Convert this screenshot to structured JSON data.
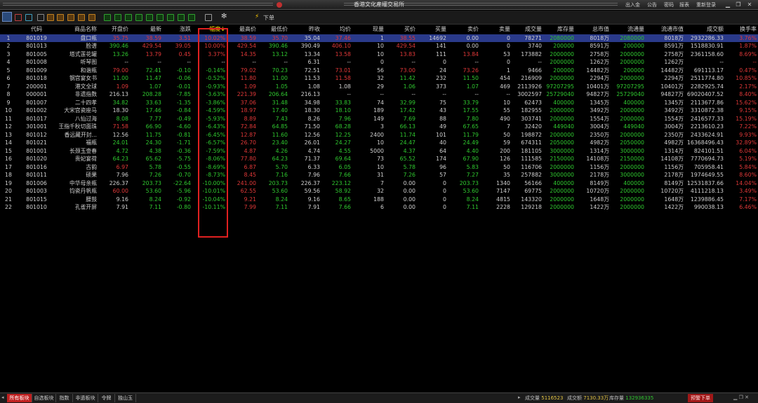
{
  "app_title": "香港文化產權交易所",
  "title_links": [
    "出入金",
    "公告",
    "密码",
    "报表",
    "重新登录"
  ],
  "window_buttons": [
    "▁",
    "❐",
    "✕"
  ],
  "toolbar": {
    "order_label": "下单"
  },
  "columns": [
    "",
    "代码",
    "商品名称",
    "开盘价",
    "最新",
    "涨跌",
    "幅度↓",
    "最高价",
    "最低价",
    "昨收",
    "均价",
    "现量",
    "买价",
    "买量",
    "卖价",
    "卖量",
    "成交量",
    "库存量",
    "总市值",
    "流通量",
    "流通市值",
    "成交额",
    "换手率"
  ],
  "rows": [
    [
      "1",
      "801019",
      "盘口瓶",
      "35.75",
      "38.59",
      "3.51",
      "10.02%",
      "38.59",
      "35.70",
      "35.04",
      "37.46",
      "1",
      "38.55",
      "14692",
      "0.00",
      "0",
      "78271",
      "2080000",
      "8018万",
      "2080000",
      "8018万",
      "2932286.33",
      "3.76%"
    ],
    [
      "2",
      "801013",
      "脸谱",
      "390.46",
      "429.54",
      "39.05",
      "10.00%",
      "429.54",
      "390.46",
      "390.49",
      "406.10",
      "10",
      "429.54",
      "141",
      "0.00",
      "0",
      "3740",
      "200000",
      "8591万",
      "200000",
      "8591万",
      "1518830.91",
      "1.87%"
    ],
    [
      "3",
      "801005",
      "塔式莲花罐",
      "13.26",
      "13.79",
      "0.45",
      "3.37%",
      "14.35",
      "13.12",
      "13.34",
      "13.58",
      "10",
      "13.83",
      "111",
      "13.84",
      "53",
      "173882",
      "2000000",
      "2758万",
      "2000000",
      "2758万",
      "2361158.60",
      "8.69%"
    ],
    [
      "4",
      "801008",
      "听琴图",
      "--",
      "--",
      "--",
      "--",
      "--",
      "--",
      "6.31",
      "--",
      "0",
      "--",
      "0",
      "--",
      "0",
      "--",
      "2000000",
      "1262万",
      "2000000",
      "1262万",
      "--",
      "--"
    ],
    [
      "5",
      "801009",
      "和谐瓶",
      "79.00",
      "72.41",
      "-0.10",
      "-0.14%",
      "79.02",
      "70.23",
      "72.51",
      "73.01",
      "56",
      "73.00",
      "24",
      "73.26",
      "1",
      "9466",
      "200000",
      "14482万",
      "200000",
      "14482万",
      "691113.17",
      "0.47%"
    ],
    [
      "6",
      "801018",
      "钢宫宴女书",
      "11.00",
      "11.47",
      "-0.06",
      "-0.52%",
      "11.80",
      "11.00",
      "11.53",
      "11.58",
      "32",
      "11.42",
      "232",
      "11.50",
      "454",
      "216909",
      "2000000",
      "2294万",
      "2000000",
      "2294万",
      "2511774.80",
      "10.85%"
    ],
    [
      "7",
      "200001",
      "港文全球",
      "1.09",
      "1.07",
      "-0.01",
      "-0.93%",
      "1.09",
      "1.05",
      "1.08",
      "1.08",
      "29",
      "1.06",
      "373",
      "1.07",
      "469",
      "2113926",
      "97207295",
      "10401万",
      "97207295",
      "10401万",
      "2282925.74",
      "2.17%"
    ],
    [
      "8",
      "000001",
      "非遗指数",
      "216.13",
      "208.28",
      "-7.85",
      "-3.63%",
      "221.39",
      "206.64",
      "216.13",
      "--",
      "--",
      "--",
      "--",
      "--",
      "--",
      "3002597",
      "25729040",
      "94827万",
      "25729040",
      "94827万",
      "69020407.52",
      "8.40%"
    ],
    [
      "9",
      "801007",
      "二十四孝",
      "34.82",
      "33.63",
      "-1.35",
      "-3.86%",
      "37.06",
      "31.48",
      "34.98",
      "33.83",
      "74",
      "32.99",
      "75",
      "33.79",
      "10",
      "62473",
      "400000",
      "1345万",
      "400000",
      "1345万",
      "2113677.86",
      "15.62%"
    ],
    [
      "10",
      "801002",
      "大宋宫瓷座马",
      "18.30",
      "17.46",
      "-0.84",
      "-4.59%",
      "18.97",
      "17.40",
      "18.30",
      "18.10",
      "189",
      "17.42",
      "43",
      "17.55",
      "55",
      "182955",
      "2000000",
      "3492万",
      "2000000",
      "3492万",
      "3310872.38",
      "9.15%"
    ],
    [
      "11",
      "801017",
      "八仙过海",
      "8.08",
      "7.77",
      "-0.49",
      "-5.93%",
      "8.89",
      "7.43",
      "8.26",
      "7.96",
      "149",
      "7.69",
      "88",
      "7.80",
      "490",
      "303741",
      "2000000",
      "1554万",
      "2000000",
      "1554万",
      "2416577.33",
      "15.19%"
    ],
    [
      "12",
      "301001",
      "王指千秋切面珠",
      "71.58",
      "66.90",
      "-4.60",
      "-6.43%",
      "72.84",
      "64.85",
      "71.50",
      "68.28",
      "3",
      "66.13",
      "49",
      "67.65",
      "7",
      "32420",
      "449040",
      "3004万",
      "449040",
      "3004万",
      "2213610.23",
      "7.22%"
    ],
    [
      "13",
      "801012",
      "香远藏开封...",
      "12.56",
      "11.75",
      "-0.81",
      "-6.45%",
      "12.87",
      "11.60",
      "12.56",
      "12.25",
      "2400",
      "11.74",
      "101",
      "11.79",
      "50",
      "198872",
      "2000000",
      "2350万",
      "2000000",
      "2350万",
      "2433624.91",
      "9.93%"
    ],
    [
      "14",
      "801021",
      "福瓶",
      "24.01",
      "24.30",
      "-1.71",
      "-6.57%",
      "26.70",
      "23.40",
      "26.01",
      "24.27",
      "10",
      "24.47",
      "40",
      "24.49",
      "59",
      "674311",
      "2050000",
      "4982万",
      "2050000",
      "4982万",
      "16368496.43",
      "32.89%"
    ],
    [
      "15",
      "801001",
      "长颈玉壶春",
      "4.72",
      "4.38",
      "-0.36",
      "-7.59%",
      "4.87",
      "4.26",
      "4.74",
      "4.55",
      "5000",
      "4.37",
      "64",
      "4.40",
      "200",
      "181105",
      "3000000",
      "1314万",
      "3000000",
      "1314万",
      "824101.51",
      "6.04%"
    ],
    [
      "16",
      "801020",
      "贵妃宴荷",
      "64.23",
      "65.62",
      "-5.75",
      "-8.06%",
      "77.80",
      "64.23",
      "71.37",
      "69.64",
      "73",
      "65.52",
      "174",
      "67.90",
      "126",
      "111585",
      "2150000",
      "14108万",
      "2150000",
      "14108万",
      "7770694.73",
      "5.19%"
    ],
    [
      "17",
      "801016",
      "古韵",
      "6.97",
      "5.78",
      "-0.55",
      "-8.69%",
      "6.87",
      "5.70",
      "6.33",
      "6.05",
      "10",
      "5.78",
      "96",
      "5.83",
      "50",
      "116706",
      "2000000",
      "1156万",
      "2000000",
      "1156万",
      "705958.41",
      "5.84%"
    ],
    [
      "18",
      "801011",
      "硕果",
      "7.96",
      "7.26",
      "-0.70",
      "-8.73%",
      "8.45",
      "7.16",
      "7.96",
      "7.66",
      "31",
      "7.26",
      "57",
      "7.27",
      "35",
      "257882",
      "3000000",
      "2178万",
      "3000000",
      "2178万",
      "1974649.55",
      "8.60%"
    ],
    [
      "19",
      "801006",
      "中华母亲瓶",
      "226.37",
      "203.73",
      "-22.64",
      "-10.00%",
      "241.00",
      "203.73",
      "226.37",
      "223.12",
      "7",
      "0.00",
      "0",
      "203.73",
      "1340",
      "56166",
      "400000",
      "8149万",
      "400000",
      "8149万",
      "12531837.66",
      "14.04%"
    ],
    [
      "20",
      "801003",
      "钧瓷丹帆瓶",
      "60.00",
      "53.60",
      "-5.96",
      "-10.01%",
      "62.55",
      "53.60",
      "59.56",
      "58.92",
      "32",
      "0.00",
      "0",
      "53.60",
      "7147",
      "69775",
      "2000000",
      "10720万",
      "2000000",
      "10720万",
      "4111218.13",
      "3.49%"
    ],
    [
      "21",
      "801015",
      "腰鼓",
      "9.16",
      "8.24",
      "-0.92",
      "-10.04%",
      "9.21",
      "8.24",
      "9.16",
      "8.65",
      "188",
      "0.00",
      "0",
      "8.24",
      "4815",
      "143320",
      "2000000",
      "1648万",
      "2000000",
      "1648万",
      "1239886.45",
      "7.17%"
    ],
    [
      "22",
      "801010",
      "孔雀开屏",
      "7.91",
      "7.11",
      "-0.80",
      "-10.11%",
      "7.99",
      "7.11",
      "7.91",
      "7.66",
      "6",
      "0.00",
      "0",
      "7.11",
      "2228",
      "129218",
      "2000000",
      "1422万",
      "2000000",
      "1422万",
      "990038.13",
      "6.46%"
    ]
  ],
  "bottom_tabs": [
    "所有板块",
    "自选板块",
    "指数",
    "非遗板块",
    "令牌",
    "独山玉"
  ],
  "status": {
    "volume_label": "成交量",
    "volume_value": "5116523",
    "amount_label": "成交额",
    "amount_value": "7130.33万",
    "stock_label": "库存量",
    "stock_value": "132936335"
  },
  "bottom_alert": "预警下单",
  "colors": {
    "up": "#e03838",
    "down": "#2fc82f",
    "selected_row": "#2a3a8a",
    "highlight_box": "#e02020",
    "sorted_header": "#ffd800"
  }
}
